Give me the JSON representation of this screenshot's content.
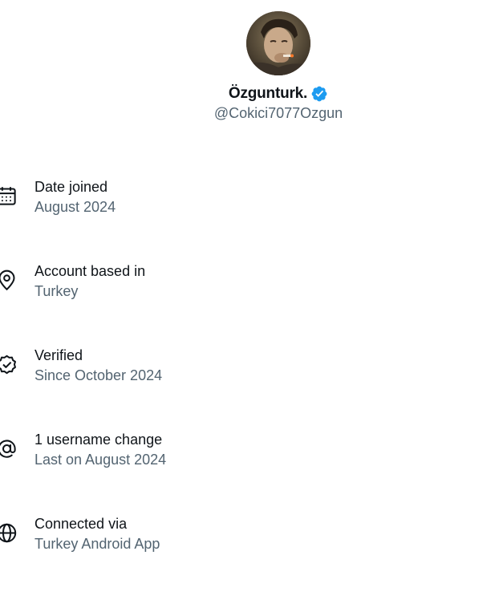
{
  "profile": {
    "display_name": "Özgunturk.",
    "handle": "@Cokici7077Ozgun",
    "verified": true,
    "accent_color": "#1d9bf0"
  },
  "info": {
    "date_joined": {
      "icon": "calendar-icon",
      "title": "Date joined",
      "value": "August 2024"
    },
    "location": {
      "icon": "location-pin-icon",
      "title": "Account based in",
      "value": "Turkey"
    },
    "verified": {
      "icon": "verified-seal-icon",
      "title": "Verified",
      "value": "Since October 2024"
    },
    "username_changes": {
      "icon": "at-sign-icon",
      "title": "1 username change",
      "value": "Last on August 2024"
    },
    "connected_via": {
      "icon": "globe-icon",
      "title": "Connected via",
      "value": "Turkey Android App"
    }
  },
  "colors": {
    "primary_text": "#0f1419",
    "secondary_text": "#536471",
    "background": "#ffffff"
  }
}
